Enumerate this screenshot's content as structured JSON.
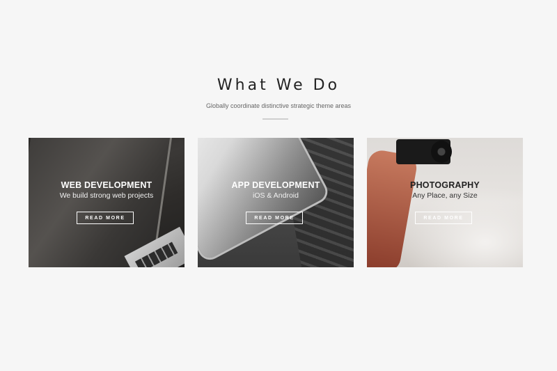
{
  "section": {
    "title": "What We Do",
    "subtitle": "Globally coordinate distinctive strategic theme areas"
  },
  "cards": [
    {
      "title": "WEB DEVELOPMENT",
      "subtitle": "We build strong web projects",
      "button_label": "READ MORE"
    },
    {
      "title": "APP DEVELOPMENT",
      "subtitle": "iOS & Android",
      "button_label": "READ MORE"
    },
    {
      "title": "PHOTOGRAPHY",
      "subtitle": "Any Place, any Size",
      "button_label": "READ MORE"
    }
  ],
  "colors": {
    "background": "#f6f6f6",
    "heading": "#222222",
    "subtitle": "#666666",
    "divider": "#cfcfcf",
    "button_border": "#ffffff"
  }
}
